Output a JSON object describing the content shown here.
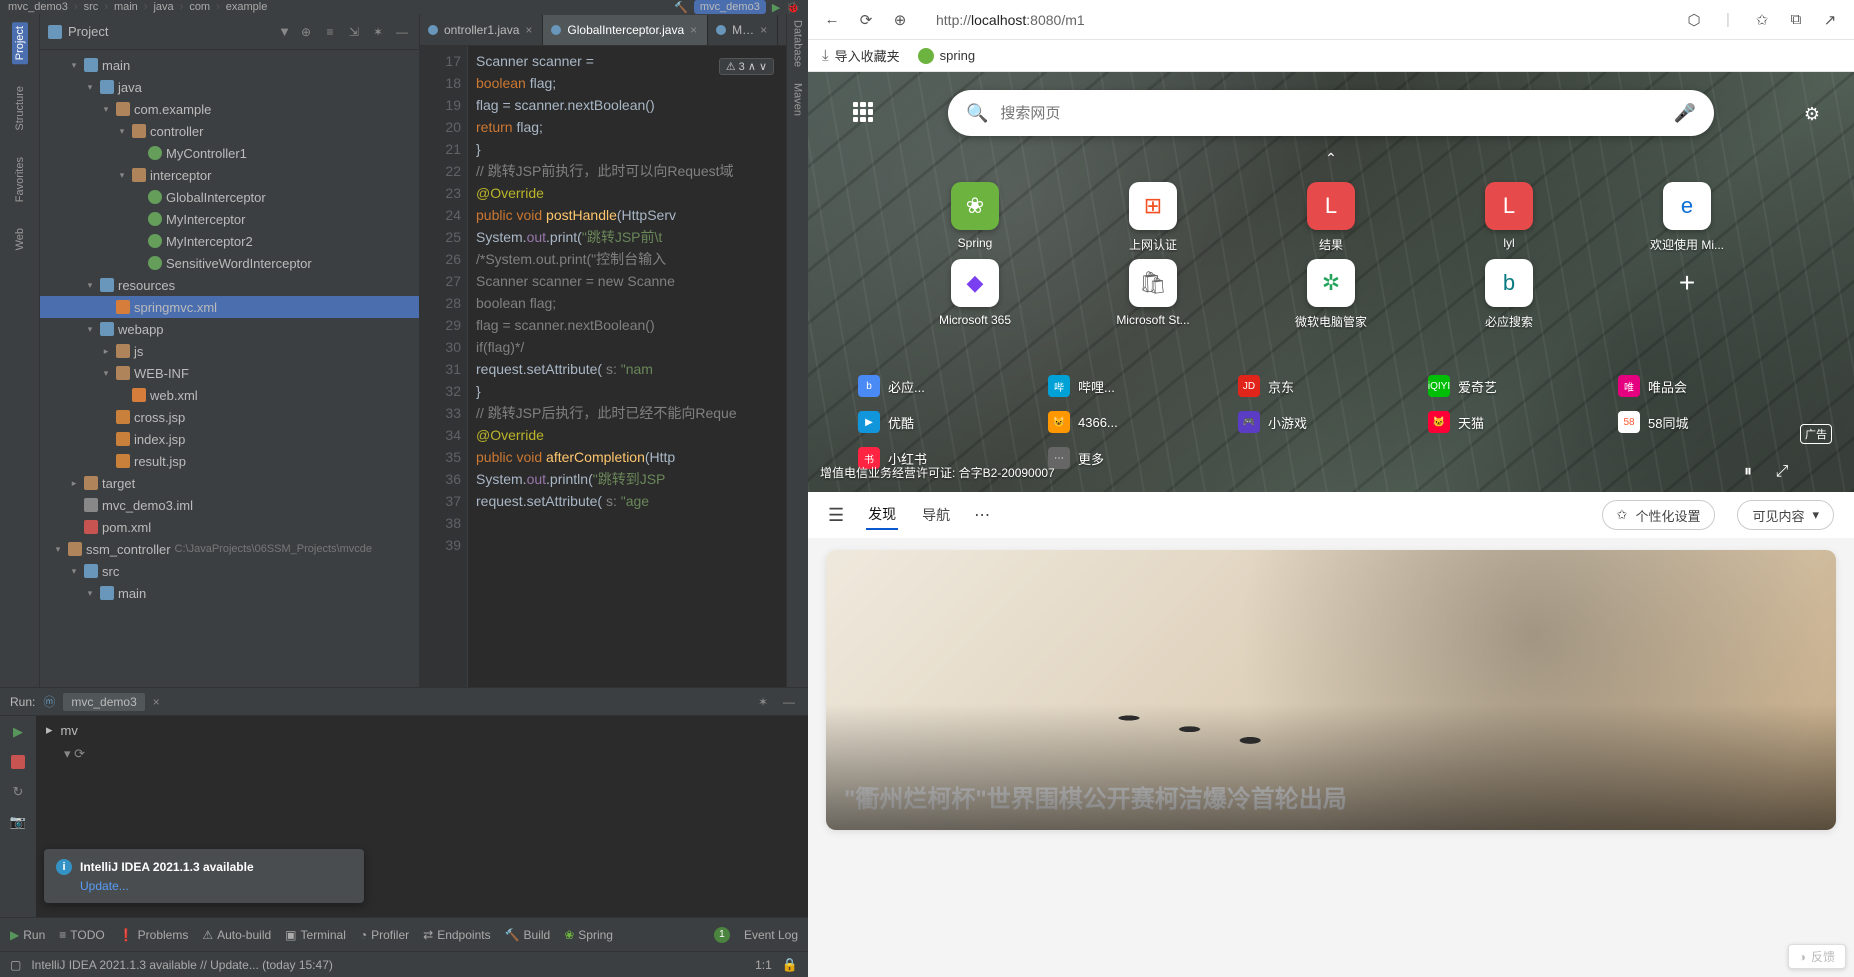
{
  "ide": {
    "breadcrumbs": [
      "mvc_demo3",
      "src",
      "main",
      "java",
      "com",
      "example"
    ],
    "runconfig": "mvc_demo3",
    "projectHeader": {
      "title": "Project"
    },
    "tree": [
      {
        "indent": 1,
        "arrow": "▾",
        "icon": "folder-blue",
        "label": "main"
      },
      {
        "indent": 2,
        "arrow": "▾",
        "icon": "folder-blue",
        "label": "java"
      },
      {
        "indent": 3,
        "arrow": "▾",
        "icon": "folder",
        "label": "com.example"
      },
      {
        "indent": 4,
        "arrow": "▾",
        "icon": "folder",
        "label": "controller"
      },
      {
        "indent": 5,
        "arrow": "",
        "icon": "java",
        "label": "MyController1"
      },
      {
        "indent": 4,
        "arrow": "▾",
        "icon": "folder",
        "label": "interceptor"
      },
      {
        "indent": 5,
        "arrow": "",
        "icon": "java",
        "label": "GlobalInterceptor"
      },
      {
        "indent": 5,
        "arrow": "",
        "icon": "java",
        "label": "MyInterceptor"
      },
      {
        "indent": 5,
        "arrow": "",
        "icon": "java",
        "label": "MyInterceptor2"
      },
      {
        "indent": 5,
        "arrow": "",
        "icon": "java",
        "label": "SensitiveWordInterceptor"
      },
      {
        "indent": 2,
        "arrow": "▾",
        "icon": "folder-blue",
        "label": "resources"
      },
      {
        "indent": 3,
        "arrow": "",
        "icon": "xml",
        "label": "springmvc.xml",
        "sel": true
      },
      {
        "indent": 2,
        "arrow": "▾",
        "icon": "folder-blue",
        "label": "webapp"
      },
      {
        "indent": 3,
        "arrow": "▸",
        "icon": "folder",
        "label": "js"
      },
      {
        "indent": 3,
        "arrow": "▾",
        "icon": "folder",
        "label": "WEB-INF"
      },
      {
        "indent": 4,
        "arrow": "",
        "icon": "xml",
        "label": "web.xml"
      },
      {
        "indent": 3,
        "arrow": "",
        "icon": "jsp",
        "label": "cross.jsp"
      },
      {
        "indent": 3,
        "arrow": "",
        "icon": "jsp",
        "label": "index.jsp"
      },
      {
        "indent": 3,
        "arrow": "",
        "icon": "jsp",
        "label": "result.jsp"
      },
      {
        "indent": 1,
        "arrow": "▸",
        "icon": "folder",
        "label": "target"
      },
      {
        "indent": 1,
        "arrow": "",
        "icon": "iml",
        "label": "mvc_demo3.iml"
      },
      {
        "indent": 1,
        "arrow": "",
        "icon": "pom",
        "label": "pom.xml"
      },
      {
        "indent": 0,
        "arrow": "▾",
        "icon": "folder",
        "label": "ssm_controller",
        "dim": "C:\\JavaProjects\\06SSM_Projects\\mvcde"
      },
      {
        "indent": 1,
        "arrow": "▾",
        "icon": "folder-blue",
        "label": "src"
      },
      {
        "indent": 2,
        "arrow": "▾",
        "icon": "folder-blue",
        "label": "main"
      }
    ],
    "editorTabs": [
      {
        "name": "ontroller1.java",
        "color": "#6897bb"
      },
      {
        "name": "GlobalInterceptor.java",
        "color": "#6897bb",
        "active": true
      },
      {
        "name": "M…",
        "color": "#6897bb"
      }
    ],
    "warnBadge": "⚠ 3  ∧ ∨",
    "code": {
      "start": 17,
      "lines": [
        "            Scanner scanner = ",
        "            <k>boolean</k> flag;",
        "            flag = scanner.nextBoolean()",
        "            <k>return</k> flag;",
        "        }",
        "",
        "        <c>// 跳转JSP前执行，此时可以向Request域</c>",
        "        <a>@Override</a>",
        "        <k>public void</k> <m>postHandle</m>(HttpServ",
        "            System.<f>out</f>.print(<s>\"跳转JSP前\\t</s>",
        "            <c>/*System.out.print(\"控制台输入</c>",
        "            <c>Scanner scanner = new Scanne</c>",
        "            <c>boolean flag;</c>",
        "            <c>flag = scanner.nextBoolean()</c>",
        "            <c>if(flag)*/</c>",
        "            request.setAttribute( <c>s:</c> <s>\"nam</s>",
        "        }",
        "",
        "        <c>// 跳转JSP后执行，此时已经不能向Reque</c>",
        "        <a>@Override</a>",
        "        <k>public void</k> <m>afterCompletion</m>(Http",
        "            System.<f>out</f>.println(<s>\"跳转到JSP</s>",
        "            request.setAttribute( <c>s:</c> <s>\"age</s>"
      ]
    },
    "rightTabs": [
      "Database",
      "Maven"
    ],
    "run": {
      "title": "Run:",
      "config": "mvc_demo3",
      "process": "mv",
      "notif": {
        "title": "IntelliJ IDEA 2021.1.3 available",
        "link": "Update..."
      }
    },
    "footer": {
      "run": "Run",
      "todo": "TODO",
      "problems": "Problems",
      "autobuild": "Auto-build",
      "terminal": "Terminal",
      "profiler": "Profiler",
      "endpoints": "Endpoints",
      "build": "Build",
      "spring": "Spring",
      "eventlog": "Event Log"
    },
    "status": {
      "msg": "IntelliJ IDEA 2021.1.3 available // Update... (today 15:47)",
      "pos": "1:1",
      "encoding": ""
    },
    "leftTabs": [
      "Project",
      "Structure",
      "Favorites",
      "Web"
    ]
  },
  "browser": {
    "url": {
      "prefix": "http://",
      "host": "localhost",
      "rest": ":8080/m1"
    },
    "favbar": {
      "import": "导入收藏夹",
      "spring": "spring"
    },
    "search": {
      "placeholder": "搜索网页"
    },
    "tiles": [
      {
        "label": "Spring",
        "bg": "#6db33f",
        "glyph": "❀"
      },
      {
        "label": "上网认证",
        "bg": "#fff",
        "glyph": "⊞",
        "color": "#f25022"
      },
      {
        "label": "结果",
        "bg": "#e64a4a",
        "glyph": "L"
      },
      {
        "label": "lyl",
        "bg": "#e64a4a",
        "glyph": "L"
      },
      {
        "label": "欢迎使用 Mi...",
        "bg": "#fff",
        "glyph": "e",
        "color": "#0b6dd6"
      },
      {
        "label": "Microsoft 365",
        "bg": "#fff",
        "glyph": "◆",
        "color": "#7b3ff2"
      },
      {
        "label": "Microsoft St...",
        "bg": "#fff",
        "glyph": "🛍",
        "color": "#666"
      },
      {
        "label": "微软电脑管家",
        "bg": "#fff",
        "glyph": "✲",
        "color": "#24a35a"
      },
      {
        "label": "必应搜索",
        "bg": "#fff",
        "glyph": "b",
        "color": "#0a7b83"
      },
      {
        "label": "",
        "plus": true
      }
    ],
    "links": [
      {
        "label": "必应...",
        "bg": "#4a8af4",
        "glyph": "b"
      },
      {
        "label": "哔哩...",
        "bg": "#00a1d6",
        "glyph": "哔"
      },
      {
        "label": "京东",
        "bg": "#e1251b",
        "glyph": "JD"
      },
      {
        "label": "爱奇艺",
        "bg": "#00be06",
        "glyph": "iQIYI"
      },
      {
        "label": "唯品会",
        "bg": "#e4007f",
        "glyph": "唯"
      },
      {
        "label": "优酷",
        "bg": "#1296db",
        "glyph": "▶"
      },
      {
        "label": "4366...",
        "bg": "#ff9800",
        "glyph": "😺"
      },
      {
        "label": "小游戏",
        "bg": "#5b3cc4",
        "glyph": "🎮"
      },
      {
        "label": "天猫",
        "bg": "#ff0036",
        "glyph": "🐱"
      },
      {
        "label": "58同城",
        "bg": "#fff",
        "glyph": "58",
        "color": "#ff552e"
      },
      {
        "label": "小红书",
        "bg": "#ff2442",
        "glyph": "书"
      },
      {
        "label": "更多",
        "bg": "#666",
        "glyph": "⋯"
      }
    ],
    "adtag": "广告",
    "license": "增值电信业务经营许可证: 合字B2-20090007",
    "feed": {
      "tabs": [
        "发现",
        "导航"
      ],
      "personalize": "个性化设置",
      "visible": "可见内容",
      "headline": "\"衢州烂柯杯\"世界围棋公开赛柯洁爆冷首轮出局"
    },
    "feedback": "反馈"
  }
}
